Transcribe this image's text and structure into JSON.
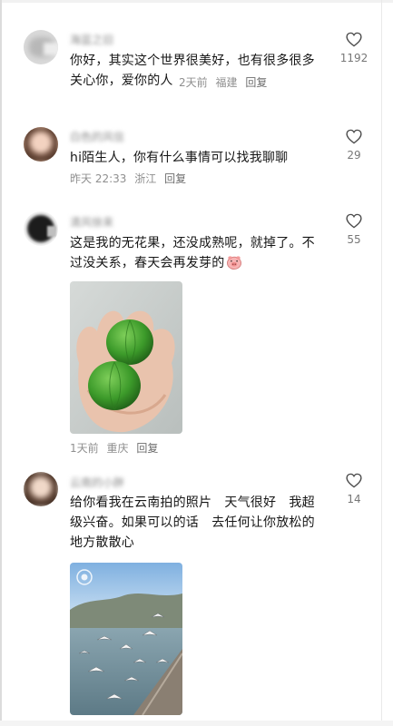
{
  "comments": [
    {
      "username": "海蓝之旧",
      "text": "你好，其实这个世界很美好，也有很多很多关心你，爱你的人",
      "time": "2天前",
      "location": "福建",
      "reply_label": "回复",
      "likes": "1192"
    },
    {
      "username": "白色的风信",
      "text": "hi陌生人，你有什么事情可以找我聊聊",
      "time": "昨天 22:33",
      "location": "浙江",
      "reply_label": "回复",
      "likes": "29"
    },
    {
      "username": "清风徐来",
      "text": "这是我的无花果，还没成熟呢，就掉了。不过没关系，春天会再发芽的",
      "emoji": "pig-face-emoji",
      "time": "1天前",
      "location": "重庆",
      "reply_label": "回复",
      "likes": "55"
    },
    {
      "username": "云南的小胖",
      "text": "给你看我在云南拍的照片　天气很好　我超级兴奋。如果可以的话　去任何让你放松的地方散散心",
      "likes": "14"
    }
  ],
  "icons": {
    "like": "heart-outline-icon"
  },
  "colors": {
    "text": "#161616",
    "meta": "#8f8f8f",
    "fig_green": "#3c9a2a",
    "lake_blue": "#6f8e9a"
  }
}
